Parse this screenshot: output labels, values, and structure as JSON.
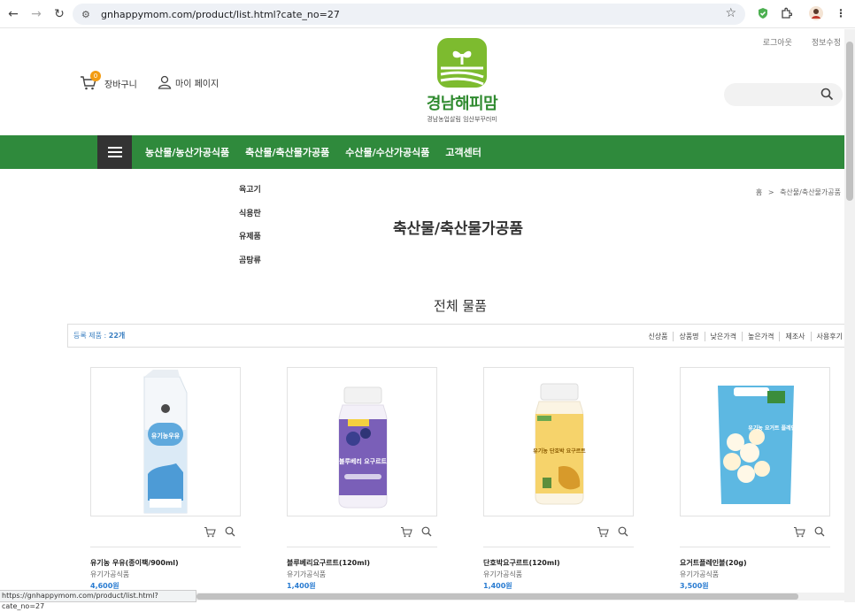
{
  "browser": {
    "url": "gnhappymom.com/product/list.html?cate_no=27",
    "status_url": "https://gnhappymom.com/product/list.html?cate_no=27"
  },
  "header": {
    "top_links": [
      "로그아웃",
      "정보수정"
    ],
    "cart_label": "장바구니",
    "cart_count": "0",
    "mypage_label": "마이 페이지",
    "logo_title": "경남해피맘",
    "logo_sub": "경남농업살림 임산부꾸러미"
  },
  "nav": {
    "items": [
      "농산물/농산가공식품",
      "축산물/축산물가공품",
      "수산물/수산가공식품",
      "고객센터"
    ]
  },
  "subcategories": [
    "육고기",
    "식용란",
    "유제품",
    "곰탕류"
  ],
  "breadcrumb": {
    "home": "홈",
    "separator": ">",
    "current": "축산물/축산물가공품"
  },
  "page": {
    "title": "축산물/축산물가공품",
    "section_title": "전체 물품"
  },
  "filter": {
    "count_label": "등록 제품 :",
    "count_value": "22개",
    "sort_options": [
      "신상품",
      "상품명",
      "낮은가격",
      "높은가격",
      "제조사",
      "사용후기"
    ]
  },
  "products": [
    {
      "name": "유기농 우유(종이팩/900ml)",
      "category": "유기가공식품",
      "price": "4,600원"
    },
    {
      "name": "블루베리요구르트(120ml)",
      "category": "유기가공식품",
      "price": "1,400원"
    },
    {
      "name": "단호박요구르트(120ml)",
      "category": "유기가공식품",
      "price": "1,400원"
    },
    {
      "name": "요거트플레인볼(20g)",
      "category": "유기가공식품",
      "price": "3,500원"
    }
  ],
  "product_images": {
    "milk_label": "유기농우유",
    "blueberry_label": "블루베리 요구르트",
    "pumpkin_label": "유기농 단호박 요구르트",
    "yogurt_label": "유기농 요거트 플레인볼"
  },
  "colors": {
    "nav_green": "#2f8a3c",
    "price_blue": "#2a7cd1",
    "badge_orange": "#f39c12"
  }
}
